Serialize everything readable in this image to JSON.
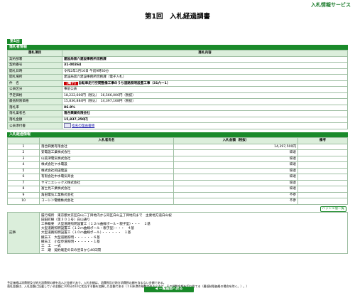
{
  "header": {
    "service": "入札情報サービス",
    "title": "第1回　入札経過調書",
    "round_tab": "第1回"
  },
  "info": {
    "section": "落札者情報",
    "col_item": "落札項目",
    "col_content": "落札内容",
    "rows": [
      {
        "label": "契約部署",
        "value": "建設局第六建設事務所庶務課",
        "bold": true
      },
      {
        "label": "契約番号",
        "value": "31-00264",
        "bold": true
      },
      {
        "label": "開札日時",
        "value": "令和2年1月16日 午前9時30分"
      },
      {
        "label": "開札場所",
        "value": "建設局第六建設事務所庶務課（電子入札）"
      },
      {
        "label": "件　名",
        "value": "自転車走行空間整備工事のうち道路照明設置工事（31六ー1）",
        "tag": "【電子】"
      },
      {
        "label": "公表区分",
        "value": "事前公表"
      },
      {
        "label": "予定価格",
        "value": "18,222,600円（税込）　16,566,000円（税抜）"
      },
      {
        "label": "最低制限価格",
        "value": "15,836,884円（税込）　14,397,168円（税抜）"
      },
      {
        "label": "落札率",
        "value": "86.9%",
        "bold": true
      },
      {
        "label": "落札業者名",
        "value": "落合興業有限会社",
        "bold": true
      },
      {
        "label": "落札金額",
        "value": "15,837,250円",
        "bold": true
      },
      {
        "label": "公表添付書",
        "value": "指名の理由書類",
        "link": true
      }
    ]
  },
  "bids": {
    "section": "入札経過情報",
    "headers": [
      "",
      "入札者氏名",
      "入札金額（税抜）",
      "備考"
    ],
    "rows": [
      {
        "no": "1",
        "name": "落合興業有限会社",
        "amount": "14,397,500円",
        "note": ""
      },
      {
        "no": "2",
        "name": "安電設工業株式会社",
        "amount": "辞退",
        "note": ""
      },
      {
        "no": "3",
        "name": "山美津電気株式会社",
        "amount": "辞退",
        "note": ""
      },
      {
        "no": "4",
        "name": "株式会社ヤ水電設",
        "amount": "辞退",
        "note": ""
      },
      {
        "no": "5",
        "name": "株式会社莉田電設",
        "amount": "辞退",
        "note": ""
      },
      {
        "no": "6",
        "name": "有限会社中水電気商会",
        "amount": "辞退",
        "note": ""
      },
      {
        "no": "7",
        "name": "ヤマニエレックス株式会社",
        "amount": "辞退",
        "note": ""
      },
      {
        "no": "8",
        "name": "富士見工業株式会社",
        "amount": "辞退",
        "note": ""
      },
      {
        "no": "9",
        "name": "角田電気工業株式会社",
        "amount": "不参",
        "note": ""
      },
      {
        "no": "10",
        "name": "コーシン電機株式会社",
        "amount": "不参",
        "note": ""
      }
    ],
    "hash_button": "ハッシュ値一覧",
    "memo_label": "記事",
    "memo_lines": [
      "履行場所　東京都文京区白山二丁目地内から同区白山五丁目地内まで　主要地方道白山祝",
      "田田町線（第３０１号）白山通り",
      "工事概要　大型道路照明設置工（１２ｍ曲線ポール・親子型）・・・　２基",
      "大型道路照明設置工（１２ｍ曲線ポール・親子型）・・・　４基",
      "大型道路照明設置工（１０ｍ曲線ポール）・・・・・・　１基",
      "撤去工　大型道路照明・・・・・・６基",
      "撤去工　小型歩道照明・・・・・・１基",
      "工　工　一式",
      "工　期　契約確定の日の翌日から40日間"
    ]
  },
  "notes": [
    "予定価格は消費税及び地方消費税の額を含んだ金額であり、入札金額は、消費税及び地方消費税の額を含まない金額である。",
    "落札金額は、入札金額に記載している金額に100分の10に相当する額を加算した金額である（１円未満の端数があるときは、その端数金額を切り捨てる（最低制限価格の場合を除く。）。）"
  ],
  "back_button": "一覧画面へ戻る"
}
